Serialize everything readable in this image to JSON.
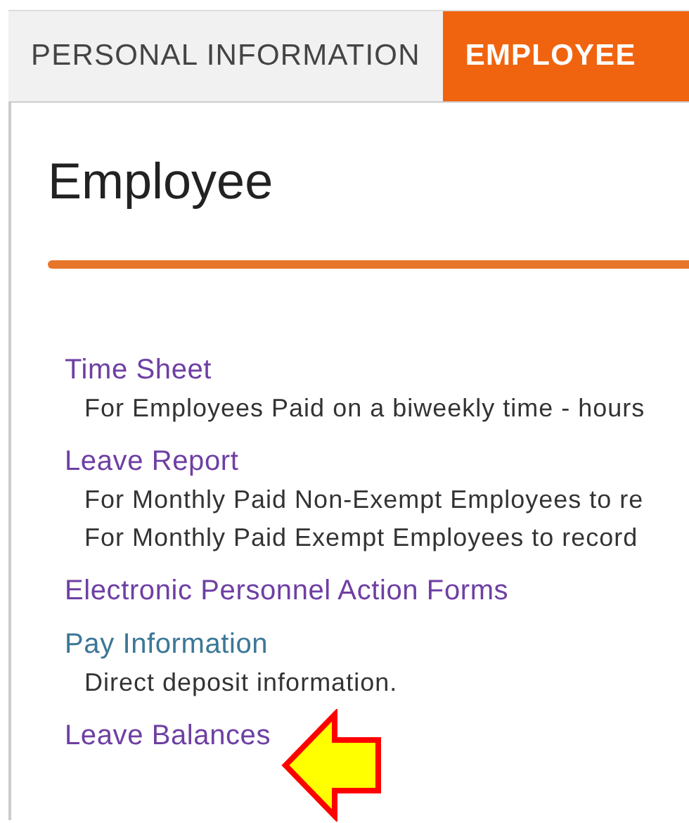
{
  "tabs": [
    {
      "label": "PERSONAL INFORMATION",
      "selected": false
    },
    {
      "label": "EMPLOYEE",
      "selected": true
    }
  ],
  "heading": "Employee",
  "links": [
    {
      "label": "Time Sheet",
      "visited": true,
      "descriptions": [
        "For Employees Paid on a biweekly time - hours"
      ]
    },
    {
      "label": "Leave Report",
      "visited": true,
      "descriptions": [
        "For Monthly Paid Non-Exempt Employees to re",
        "For Monthly Paid Exempt Employees to record"
      ]
    },
    {
      "label": "Electronic Personnel Action Forms",
      "visited": true
    },
    {
      "label": "Pay Information",
      "visited": false,
      "descriptions": [
        "Direct deposit information."
      ]
    },
    {
      "label": "Leave Balances",
      "visited": true
    }
  ]
}
